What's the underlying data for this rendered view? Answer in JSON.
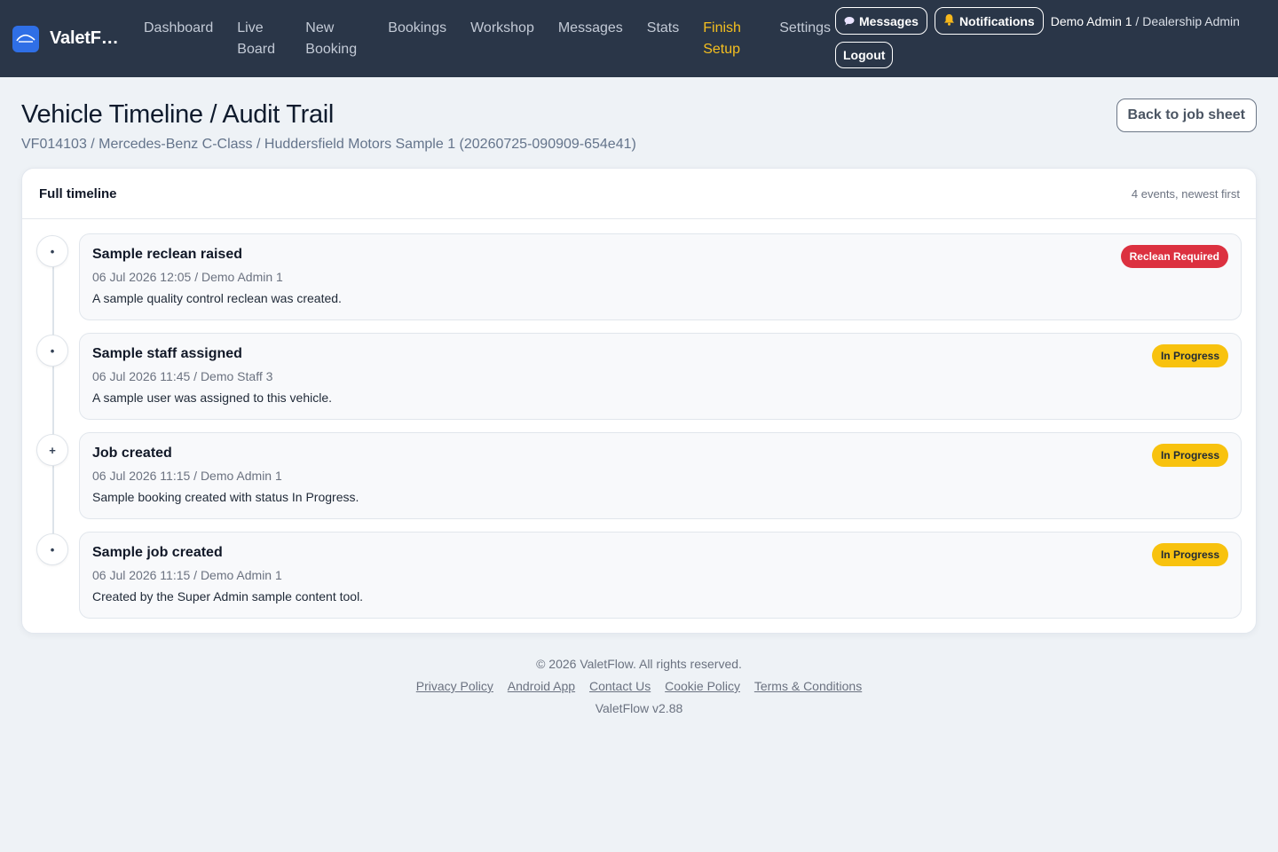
{
  "brand": {
    "name": "ValetF…",
    "logo_icon": "car-icon"
  },
  "nav": {
    "links": [
      {
        "label": "Dashboard"
      },
      {
        "label": "Live Board"
      },
      {
        "label": "New Booking"
      },
      {
        "label": "Bookings"
      },
      {
        "label": "Workshop"
      },
      {
        "label": "Messages"
      },
      {
        "label": "Stats"
      },
      {
        "label": "Finish Setup"
      },
      {
        "label": "Settings"
      }
    ],
    "messages_btn": "Messages",
    "notifications_btn": "Notifications",
    "user_name": "Demo Admin 1",
    "user_role": " / Dealership Admin",
    "logout_btn": "Logout",
    "accent_color": "#f5bf1f"
  },
  "header": {
    "title": "Vehicle Timeline / Audit Trail",
    "subtitle": "VF014103 / Mercedes-Benz C-Class / Huddersfield Motors Sample 1 (20260725-090909-654e41)",
    "back_btn": "Back to job sheet"
  },
  "card": {
    "title": "Full timeline",
    "meta": "4 events, newest first"
  },
  "events": [
    {
      "dot": "•",
      "title": "Sample reclean raised",
      "meta": "06 Jul 2026 12:05 / Demo Admin 1",
      "desc": "A sample quality control reclean was created.",
      "badge": "Reclean Required",
      "badge_color": "#dc3140"
    },
    {
      "dot": "•",
      "title": "Sample staff assigned",
      "meta": "06 Jul 2026 11:45 / Demo Staff 3",
      "desc": "A sample user was assigned to this vehicle.",
      "badge": "In Progress",
      "badge_color": "#f8c20e"
    },
    {
      "dot": "+",
      "title": "Job created",
      "meta": "06 Jul 2026 11:15 / Demo Admin 1",
      "desc": "Sample booking created with status In Progress.",
      "badge": "In Progress",
      "badge_color": "#f8c20e"
    },
    {
      "dot": "•",
      "title": "Sample job created",
      "meta": "06 Jul 2026 11:15 / Demo Admin 1",
      "desc": "Created by the Super Admin sample content tool.",
      "badge": "In Progress",
      "badge_color": "#f8c20e"
    }
  ],
  "footer": {
    "copyright": "© 2026 ValetFlow. All rights reserved.",
    "links": [
      "Privacy Policy",
      "Android App",
      "Contact Us",
      "Cookie Policy",
      "Terms & Conditions"
    ],
    "version": "ValetFlow v2.88"
  }
}
